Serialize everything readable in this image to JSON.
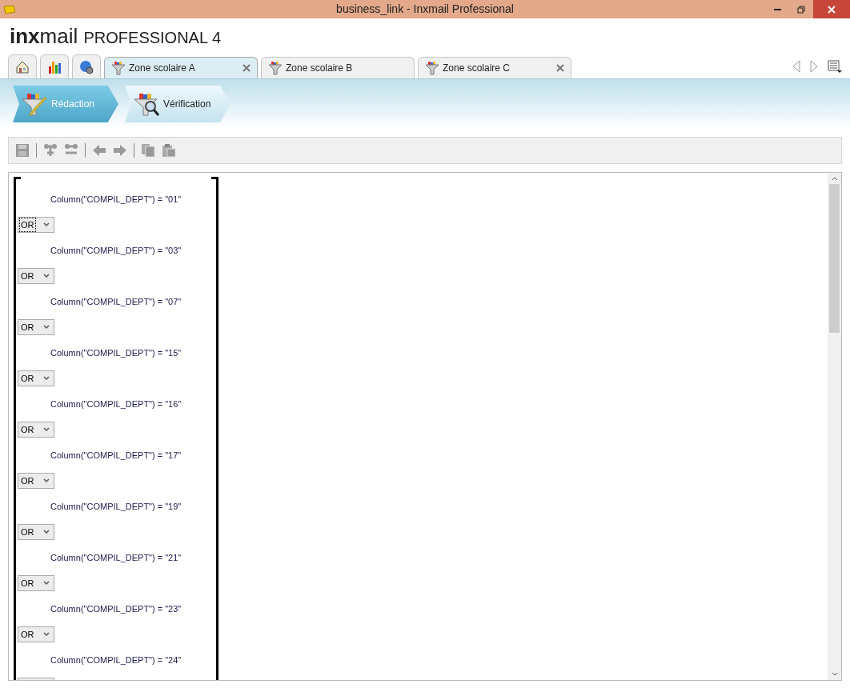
{
  "window": {
    "title": "business_link - Inxmail Professional"
  },
  "logo": {
    "brand_bold": "inx",
    "brand_light": "mail",
    "product": "PROFESSIONAL 4"
  },
  "tabs": [
    {
      "kind": "icon",
      "selected": false
    },
    {
      "kind": "icon",
      "selected": false
    },
    {
      "kind": "icon",
      "selected": false
    },
    {
      "kind": "doc",
      "label": "Zone scolaire A",
      "selected": true,
      "closable": true
    },
    {
      "kind": "doc",
      "label": "Zone scolaire B",
      "selected": false,
      "closable": false
    },
    {
      "kind": "doc",
      "label": "Zone scolaire C",
      "selected": false,
      "closable": true
    }
  ],
  "steps": [
    {
      "label": "Rédaction",
      "selected": true
    },
    {
      "label": "Vérification",
      "selected": false
    }
  ],
  "conditions": [
    {
      "text": "Column(\"COMPIL_DEPT\") = \"01\"",
      "operator": "OR",
      "focused": true
    },
    {
      "text": "Column(\"COMPIL_DEPT\") = \"03\"",
      "operator": "OR",
      "focused": false
    },
    {
      "text": "Column(\"COMPIL_DEPT\") = \"07\"",
      "operator": "OR",
      "focused": false
    },
    {
      "text": "Column(\"COMPIL_DEPT\") = \"15\"",
      "operator": "OR",
      "focused": false
    },
    {
      "text": "Column(\"COMPIL_DEPT\") = \"16\"",
      "operator": "OR",
      "focused": false
    },
    {
      "text": "Column(\"COMPIL_DEPT\") = \"17\"",
      "operator": "OR",
      "focused": false
    },
    {
      "text": "Column(\"COMPIL_DEPT\") = \"19\"",
      "operator": "OR",
      "focused": false
    },
    {
      "text": "Column(\"COMPIL_DEPT\") = \"21\"",
      "operator": "OR",
      "focused": false
    },
    {
      "text": "Column(\"COMPIL_DEPT\") = \"23\"",
      "operator": "OR",
      "focused": false
    },
    {
      "text": "Column(\"COMPIL_DEPT\") = \"24\""
    }
  ]
}
